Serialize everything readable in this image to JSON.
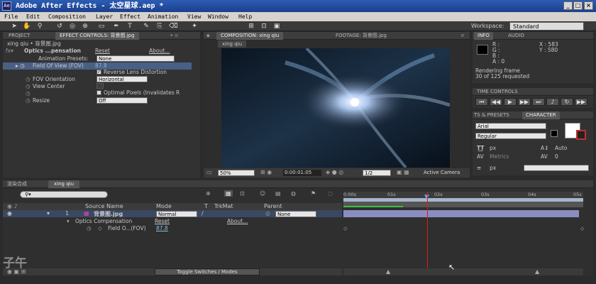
{
  "window": {
    "app_icon": "Ae",
    "title": "Adobe After Effects - 太空星球.aep *",
    "btn_min": "_",
    "btn_max": "□",
    "btn_close": "×"
  },
  "menu": [
    "File",
    "Edit",
    "Composition",
    "Layer",
    "Effect",
    "Animation",
    "View",
    "Window",
    "Help"
  ],
  "toolbar": {
    "workspace_label": "Workspace:",
    "workspace_value": "Standard"
  },
  "left_panel": {
    "tab_project": "PROJECT",
    "tab_effects": "EFFECT CONTROLS: 背景图.jpg",
    "breadcrumb": "xing qiu • 背景图.jpg",
    "effect_name": "Optics ...pensation",
    "reset": "Reset",
    "about": "About...",
    "anim_presets_label": "Animation Presets:",
    "anim_presets_value": "None",
    "props": [
      {
        "name": "Field Of View (FOV)",
        "value": "87.8"
      },
      {
        "name": "",
        "value": "Reverse Lens Distortion"
      },
      {
        "name": "FOV Orientation",
        "value": "Horizontal"
      },
      {
        "name": "View Center",
        "value": ""
      },
      {
        "name": "",
        "value": "Optimal Pixels (Invalidates R"
      },
      {
        "name": "Resize",
        "value": "Off"
      }
    ]
  },
  "comp_panel": {
    "tab_comp": "COMPOSITION: xing qiu",
    "tab_footage": "FOOTAGE: 背景图.jpg",
    "comp_name": "xing qiu",
    "zoom": "50%",
    "timecode": "0:00:01:05",
    "resolution": "1/2",
    "camera": "Active Camera"
  },
  "info_panel": {
    "tab_info": "INFO",
    "tab_audio": "AUDIO",
    "r": "R :",
    "g": "G :",
    "b": "B :",
    "a": "A : 0",
    "x": "X : 583",
    "y": "Y : 580",
    "status1": "Rendering frame",
    "status2": "30 of 125 requested"
  },
  "time_controls": {
    "title": "TIME CONTROLS"
  },
  "character": {
    "tab_presets": "TS & PRESETS",
    "tab_char": "CHARACTER",
    "font": "Arial",
    "style": "Regular",
    "size_unit": "px",
    "leading": "Auto",
    "metrics": "Metrics",
    "tracking": "0",
    "stroke_unit": "px"
  },
  "timeline": {
    "tab_render": "渲染合成",
    "tab_comp": "xing qiu",
    "col_source": "Source Name",
    "col_mode": "Mode",
    "col_t": "T",
    "col_trkmat": "TrkMat",
    "col_parent": "Parent",
    "layer_num": "1",
    "layer_name": "背景图.jpg",
    "layer_mode": "Normal",
    "layer_parent": "None",
    "effect_row": "Optics Compensation",
    "effect_reset": "Reset",
    "effect_about": "About...",
    "prop_row": "Field O...(FOV)",
    "prop_value": "87.8",
    "ticks": [
      "0:00s",
      "01s",
      "02s",
      "03s",
      "04s",
      "05s"
    ],
    "toggle_label": "Toggle Switches / Modes",
    "search_placeholder": ""
  },
  "watermark": "子午"
}
